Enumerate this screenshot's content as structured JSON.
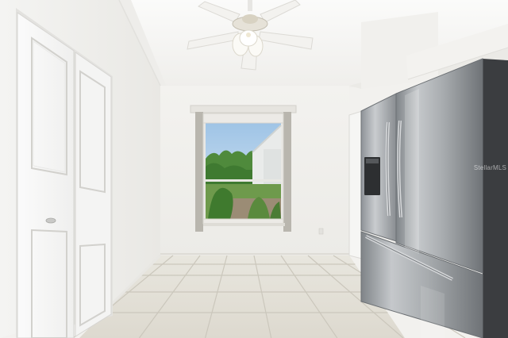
{
  "photo": {
    "watermark": "StellarMLS",
    "palette": {
      "wall": "#f0efec",
      "ceiling": "#f6f5f2",
      "floor": "#e6e3da",
      "grout": "#c9c5ba",
      "steel": "#9da1a5",
      "sky": "#b8d3ea",
      "foliage": "#4c8a3a"
    },
    "objects": [
      "bifold-closet-door",
      "window-with-garden-view",
      "ceiling-fan",
      "stainless-french-door-refrigerator",
      "interior-door",
      "tile-floor"
    ]
  }
}
